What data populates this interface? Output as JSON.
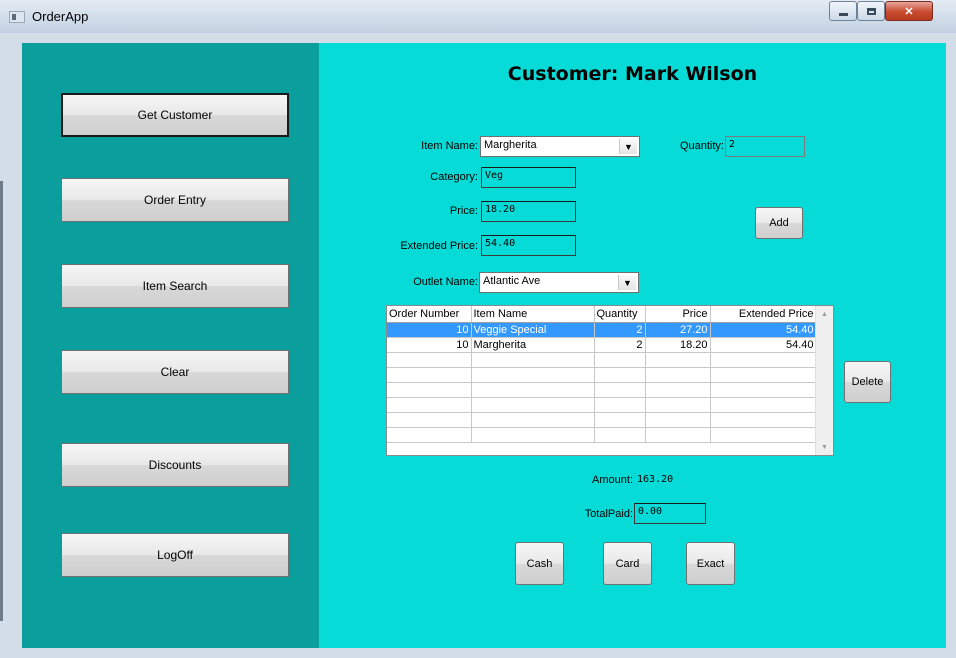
{
  "window": {
    "title": "OrderApp"
  },
  "sidebar": {
    "buttons": [
      {
        "label": "Get Customer"
      },
      {
        "label": "Order Entry"
      },
      {
        "label": "Item Search"
      },
      {
        "label": "Clear"
      },
      {
        "label": "Discounts"
      },
      {
        "label": "LogOff"
      }
    ]
  },
  "header": {
    "customer_title": "Customer: Mark Wilson"
  },
  "form": {
    "item_name": {
      "label": "Item Name:",
      "value": "Margherita"
    },
    "quantity": {
      "label": "Quantity:",
      "value": "2"
    },
    "category": {
      "label": "Category:",
      "value": "Veg"
    },
    "price": {
      "label": "Price:",
      "value": "18.20"
    },
    "extended_price": {
      "label": "Extended Price:",
      "value": "54.40"
    },
    "outlet_name": {
      "label": "Outlet Name:",
      "value": "Atlantic Ave"
    },
    "add_label": "Add",
    "delete_label": "Delete"
  },
  "grid": {
    "columns": [
      "Order Number",
      "Item Name",
      "Quantity",
      "Price",
      "Extended Price"
    ],
    "rows": [
      {
        "order_number": "10",
        "item_name": "Veggie Special",
        "quantity": "2",
        "price": "27.20",
        "extended_price": "54.40",
        "selected": true
      },
      {
        "order_number": "10",
        "item_name": "Margherita",
        "quantity": "2",
        "price": "18.20",
        "extended_price": "54.40",
        "selected": false
      }
    ],
    "selection_color": "#3399ff"
  },
  "payment": {
    "amount_label": "Amount:",
    "amount_value": "163.20",
    "total_paid_label": "TotalPaid:",
    "total_paid_value": "0.00",
    "cash_label": "Cash",
    "card_label": "Card",
    "exact_label": "Exact"
  },
  "colors": {
    "sidebar_bg": "#0a9e9c",
    "content_bg": "#06dbd7"
  }
}
